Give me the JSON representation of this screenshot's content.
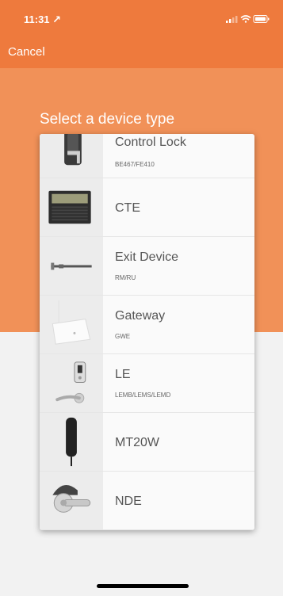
{
  "status_bar": {
    "time": "11:31 ↗",
    "icons": [
      "signal-icon",
      "wifi-icon",
      "battery-icon"
    ]
  },
  "nav": {
    "cancel_label": "Cancel"
  },
  "header": {
    "title": "Select a device type"
  },
  "devices": [
    {
      "name": "Control Lock",
      "models": "BE467/FE410",
      "icon": "control-lock-icon"
    },
    {
      "name": "CTE",
      "models": "",
      "icon": "cte-icon"
    },
    {
      "name": "Exit Device",
      "models": "RM/RU",
      "icon": "exit-device-icon"
    },
    {
      "name": "Gateway",
      "models": "GWE",
      "icon": "gateway-icon"
    },
    {
      "name": "LE",
      "models": "LEMB/LEMS/LEMD",
      "icon": "le-lock-icon"
    },
    {
      "name": "MT20W",
      "models": "",
      "icon": "mt20w-reader-icon"
    },
    {
      "name": "NDE",
      "models": "",
      "icon": "nde-lever-icon"
    }
  ],
  "colors": {
    "header_orange": "#ee7a3d",
    "band_orange": "#f19158",
    "sheet_bg": "#fafafa"
  }
}
